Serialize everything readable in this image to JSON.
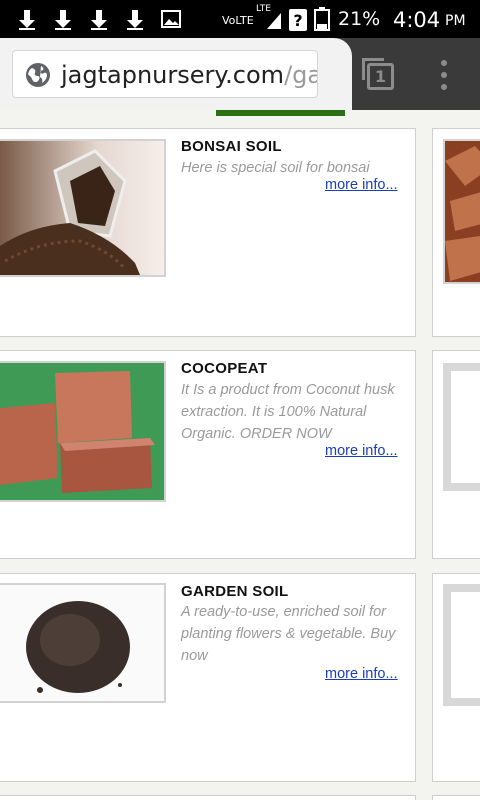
{
  "status_bar": {
    "network_label": "VoLTE",
    "lte_label": "LTE",
    "battery_percent": "21%",
    "time": "4:04",
    "ampm": "PM",
    "notification_icons": [
      "download-arrow-icon",
      "download-arrow-icon",
      "download-arrow-icon",
      "download-arrow-icon",
      "image-icon"
    ]
  },
  "browser": {
    "url_domain": "jagtapnursery.com",
    "url_path": "/ga",
    "tab_count": "1"
  },
  "products": [
    {
      "title": "BONSAI SOIL",
      "description": "Here is special soil for bonsai",
      "more": "more info..."
    },
    {
      "title": "COCOPEAT",
      "description": "It Is a product from Coconut husk extraction. It is 100% Natural Organic. ORDER NOW",
      "more": "more info..."
    },
    {
      "title": "GARDEN SOIL",
      "description": "A ready-to-use, enriched soil for planting flowers & vegetable. Buy now",
      "more": "more info..."
    }
  ],
  "colors": {
    "accent_green": "#2a6f12",
    "link": "#1a3fb8",
    "chrome": "#3a3a3a"
  }
}
